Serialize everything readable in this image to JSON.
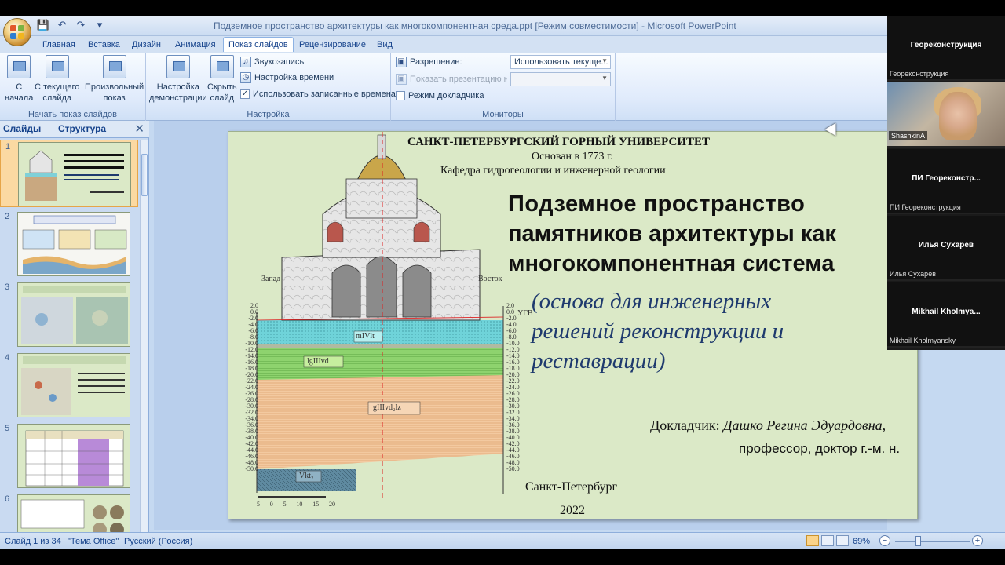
{
  "window": {
    "title": "Подземное пространство архитектуры как многокомпонентная среда.ppt [Режим совместимости] - Microsoft PowerPoint"
  },
  "ribbon": {
    "tabs": [
      {
        "label": "Главная"
      },
      {
        "label": "Вставка"
      },
      {
        "label": "Дизайн"
      },
      {
        "label": "Анимация"
      },
      {
        "label": "Показ слайдов",
        "active": true
      },
      {
        "label": "Рецензирование"
      },
      {
        "label": "Вид"
      }
    ],
    "start_group": {
      "label": "Начать показ слайдов",
      "from_start": "С\nначала",
      "from_current": "С текущего\nслайда",
      "custom": "Произвольный\nпоказ"
    },
    "setup_group": {
      "label": "Настройка",
      "setup_show": "Настройка\nдемонстрации",
      "hide_slide": "Скрыть\nслайд",
      "record_narration": "Звукозапись",
      "rehearse_timings": "Настройка времени",
      "use_timings": "Использовать записанные времена",
      "use_timings_checked": true
    },
    "monitors_group": {
      "label": "Мониторы",
      "resolution_label": "Разрешение:",
      "resolution_value": "Использовать текуще...",
      "show_on_label": "Показать презентацию на:",
      "show_on_value": "",
      "presenter_view": "Режим докладчика",
      "presenter_view_checked": false
    }
  },
  "left_pane": {
    "tab_slides": "Слайды",
    "tab_outline": "Структура",
    "thumbnails": [
      {
        "num": "1",
        "selected": true
      },
      {
        "num": "2"
      },
      {
        "num": "3"
      },
      {
        "num": "4"
      },
      {
        "num": "5"
      },
      {
        "num": "6"
      }
    ]
  },
  "slide": {
    "university": "САНКТ-ПЕТЕРБУРГСКИЙ ГОРНЫЙ УНИВЕРСИТЕТ",
    "founded": "Основан в 1773 г.",
    "department": "Кафедра гидрогеологии и инженерной геологии",
    "title_lines": [
      "Подземное пространство",
      "памятников архитектуры как",
      "многокомпонентная система"
    ],
    "subtitle_lines": [
      "(основа для инженерных",
      "решений реконструкции и",
      "реставрации)"
    ],
    "reporter_label": "Докладчик",
    "reporter_name": "Дашко Регина Эдуардовна,",
    "rank": "профессор, доктор г.-м. н.",
    "city": "Санкт-Петербург",
    "year": "2022",
    "diagram": {
      "west": "Запад",
      "east": "Восток",
      "utv": "УГВ",
      "layers": [
        "mIVlt",
        "lgIIIvd",
        "gIIIvd₂lz",
        "Vkt₂"
      ],
      "scale": [
        "5",
        "0",
        "5",
        "10",
        "15",
        "20"
      ],
      "depth_left": [
        "2.0",
        "0.0",
        "-2.0",
        "-4.0",
        "-6.0",
        "-8.0",
        "-10.0",
        "-12.0",
        "-14.0",
        "-16.0",
        "-18.0",
        "-20.0",
        "-22.0",
        "-24.0",
        "-26.0",
        "-28.0",
        "-30.0",
        "-32.0",
        "-34.0",
        "-36.0",
        "-38.0",
        "-40.0",
        "-42.0",
        "-44.0",
        "-46.0",
        "-48.0",
        "-50.0"
      ],
      "depth_right": [
        "2.0",
        "0.0",
        "-2.0",
        "-4.0",
        "-6.0",
        "-8.0",
        "-10.0",
        "-12.0",
        "-14.0",
        "-16.0",
        "-18.0",
        "-20.0",
        "-22.0",
        "-24.0",
        "-26.0",
        "-28.0",
        "-30.0",
        "-32.0",
        "-34.0",
        "-36.0",
        "-38.0",
        "-40.0",
        "-42.0",
        "-44.0",
        "-46.0",
        "-48.0",
        "-50.0"
      ]
    }
  },
  "statusbar": {
    "slide_info": "Слайд 1 из 34",
    "theme": "\"Тема Office\"",
    "language": "Русский (Россия)",
    "zoom": "69%"
  },
  "participants": [
    {
      "name": "Георeконструкция",
      "sub": "Георeконструкция",
      "camera": false
    },
    {
      "name": "",
      "sub": "ShashkinA",
      "camera": true
    },
    {
      "name": "ПИ  Георeконстр...",
      "sub": "ПИ Георeконструкция",
      "camera": false
    },
    {
      "name": "Илья Сухарев",
      "sub": "Илья Сухарев",
      "camera": false
    },
    {
      "name": "Mikhail  Kholmya...",
      "sub": "Mikhail Kholmyansky",
      "camera": false
    }
  ]
}
